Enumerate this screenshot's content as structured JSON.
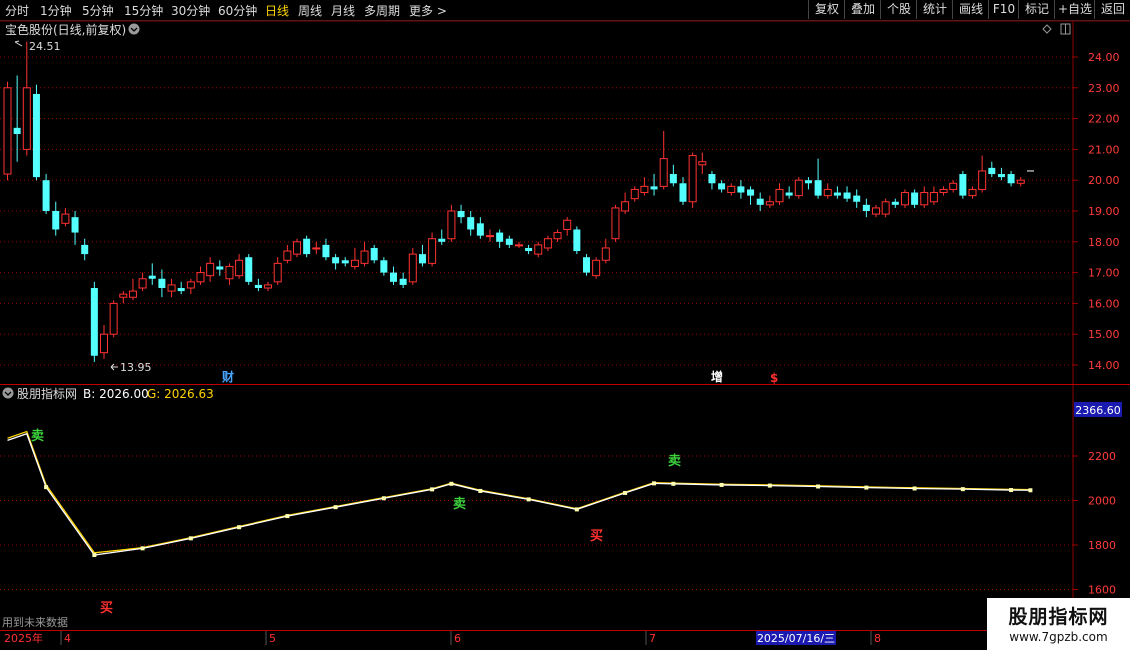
{
  "periods": [
    "分时",
    "1分钟",
    "5分钟",
    "15分钟",
    "30分钟",
    "60分钟",
    "日线",
    "周线",
    "月线",
    "多周期",
    "更多 >"
  ],
  "active_period": "日线",
  "toolbar": [
    "复权",
    "叠加",
    "个股",
    "统计",
    "画线",
    "F10",
    "标记",
    "+自选",
    "返回"
  ],
  "main_chart": {
    "title": "宝色股份(日线,前复权)",
    "high_label": "24.51",
    "low_label": "13.95",
    "y_ticks": [
      "24.00",
      "23.00",
      "22.00",
      "21.00",
      "20.00",
      "19.00",
      "18.00",
      "17.00",
      "16.00",
      "15.00",
      "14.00"
    ],
    "markers": [
      {
        "text": "财",
        "color": "#4aa3ff"
      },
      {
        "text": "增",
        "color": "#ffffff"
      },
      {
        "text": "$",
        "color": "#ff3030"
      }
    ],
    "up_color": "#ff3232",
    "down_color": "#54ffff"
  },
  "indicator": {
    "name": "股朋指标网",
    "b_label": "B: 2026.00",
    "g_label": "G: 2026.63",
    "current_value": "2366.60",
    "y_ticks": [
      "2200",
      "2000",
      "1800",
      "1600"
    ],
    "signals": [
      "卖",
      "买",
      "卖",
      "买",
      "卖"
    ],
    "future_note": "用到未来数据",
    "b_color": "#ffffff",
    "g_color": "#ffd400"
  },
  "time_axis": {
    "labels": [
      "2025年",
      "4",
      "5",
      "6",
      "7",
      "8"
    ],
    "cursor_date": "2025/07/16/三"
  },
  "watermark": {
    "title": "股朋指标网",
    "url": "www.7gpzb.com"
  }
}
